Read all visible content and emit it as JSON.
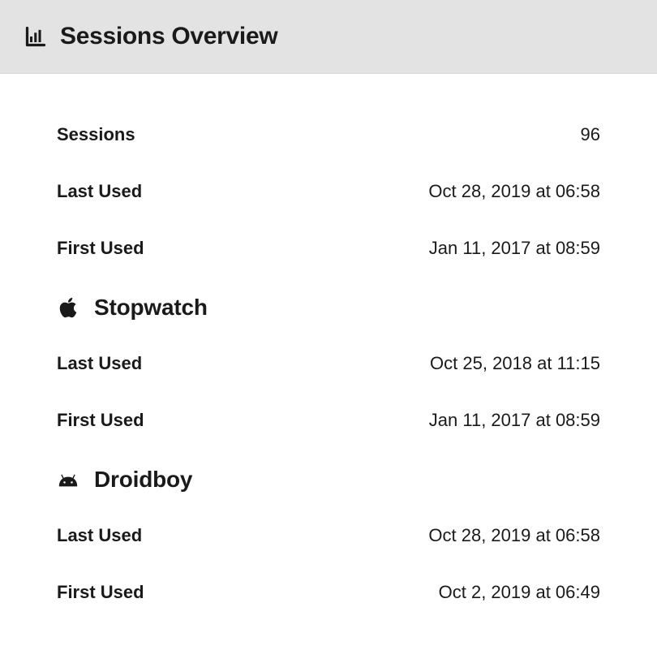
{
  "header": {
    "title": "Sessions Overview"
  },
  "summary": {
    "sessions_label": "Sessions",
    "sessions_value": "96",
    "last_used_label": "Last Used",
    "last_used_value": "Oct 28, 2019 at 06:58",
    "first_used_label": "First Used",
    "first_used_value": "Jan 11, 2017 at 08:59"
  },
  "apps": [
    {
      "icon": "apple",
      "name": "Stopwatch",
      "last_used_label": "Last Used",
      "last_used_value": "Oct 25, 2018 at 11:15",
      "first_used_label": "First Used",
      "first_used_value": "Jan 11, 2017 at 08:59"
    },
    {
      "icon": "android",
      "name": "Droidboy",
      "last_used_label": "Last Used",
      "last_used_value": "Oct 28, 2019 at 06:58",
      "first_used_label": "First Used",
      "first_used_value": "Oct 2, 2019 at 06:49"
    }
  ]
}
